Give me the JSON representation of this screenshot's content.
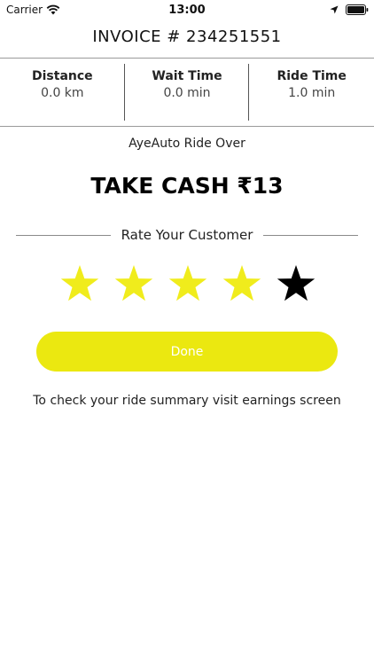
{
  "status_bar": {
    "carrier": "Carrier",
    "time": "13:00",
    "icons": [
      "wifi-icon",
      "location-arrow-icon",
      "battery-icon"
    ]
  },
  "invoice": {
    "title": "INVOICE # 234251551"
  },
  "stats": [
    {
      "label": "Distance",
      "value": "0.0 km"
    },
    {
      "label": "Wait Time",
      "value": "0.0 min"
    },
    {
      "label": "Ride Time",
      "value": "1.0 min"
    }
  ],
  "ride": {
    "status": "AyeAuto Ride Over",
    "cash_prompt": "TAKE CASH ₹13"
  },
  "rating": {
    "heading": "Rate Your Customer",
    "value": 4,
    "max": 5,
    "filled_color": "#f0ec1c",
    "empty_color": "#000000"
  },
  "actions": {
    "done_label": "Done",
    "button_color": "#ebe810"
  },
  "footer": {
    "summary_text": "To check your ride summary visit earnings screen"
  }
}
